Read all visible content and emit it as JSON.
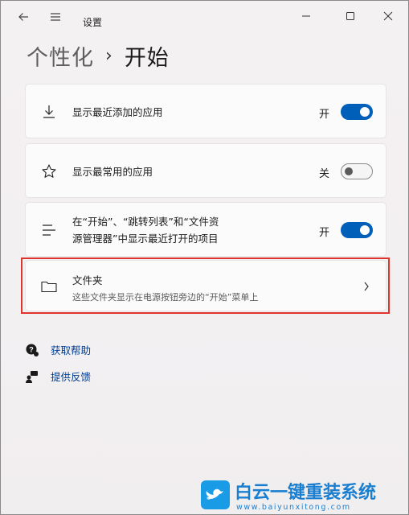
{
  "window": {
    "title": "设置"
  },
  "breadcrumb": {
    "parent": "个性化",
    "separator": "›",
    "current": "开始"
  },
  "settings": [
    {
      "label": "显示最近添加的应用",
      "state": "开",
      "toggle": "on",
      "icon": "download-icon"
    },
    {
      "label": "显示最常用的应用",
      "state": "关",
      "toggle": "off",
      "icon": "star-icon"
    },
    {
      "label_line1": "在“开始”、“跳转列表”和“文件资",
      "label_line2": "源管理器”中显示最近打开的项目",
      "state": "开",
      "toggle": "on",
      "icon": "list-lines-icon"
    }
  ],
  "folders": {
    "title": "文件夹",
    "subtitle": "这些文件夹显示在电源按钮旁边的“开始”菜单上"
  },
  "links": {
    "help": "获取帮助",
    "feedback": "提供反馈"
  },
  "watermark": {
    "text": "白云一键重装系统",
    "url": "www.baiyunxitong.com"
  },
  "colors": {
    "accent": "#005fb8",
    "link": "#003e92",
    "highlight": "#e0342e"
  }
}
